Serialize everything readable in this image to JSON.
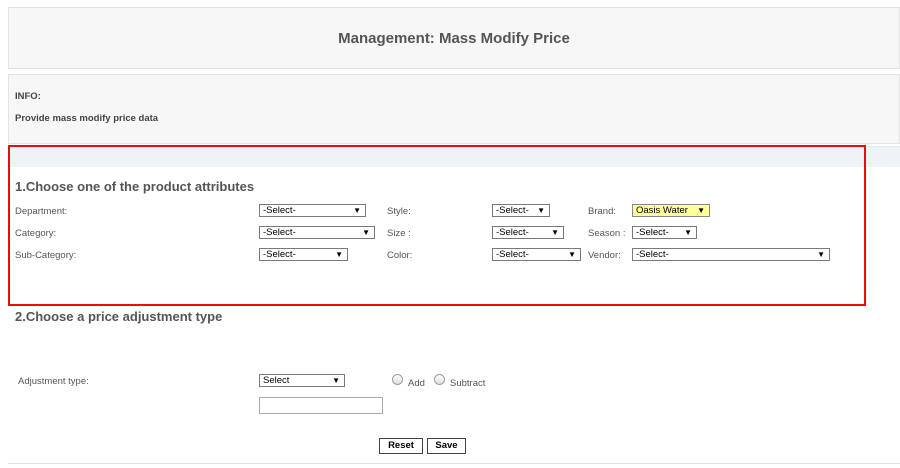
{
  "header": {
    "title": "Management: Mass Modify Price"
  },
  "info": {
    "label": "INFO:",
    "description": "Provide mass modify price data"
  },
  "section1": {
    "heading": "1.Choose one of the product attributes",
    "department": {
      "label": "Department:",
      "value": "-Select-"
    },
    "category": {
      "label": "Category:",
      "value": "-Select-"
    },
    "subcategory": {
      "label": "Sub-Category:",
      "value": "-Select-"
    },
    "style": {
      "label": "Style:",
      "value": "-Select-"
    },
    "size": {
      "label": "Size :",
      "value": "-Select-"
    },
    "color": {
      "label": "Color:",
      "value": "-Select-"
    },
    "brand": {
      "label": "Brand:",
      "value": "Oasis Water"
    },
    "season": {
      "label": "Season :",
      "value": "-Select-"
    },
    "vendor": {
      "label": "Vendor:",
      "value": "-Select-"
    }
  },
  "section2": {
    "heading": "2.Choose a price adjustment type",
    "adjustment_label": "Adjustment type:",
    "adjustment_value": "Select",
    "radio_add": "Add",
    "radio_subtract": "Subtract",
    "amount_value": ""
  },
  "buttons": {
    "reset": "Reset",
    "save": "Save"
  },
  "colors": {
    "highlight_border": "#e31010",
    "brand_highlight": "#ffff99"
  }
}
